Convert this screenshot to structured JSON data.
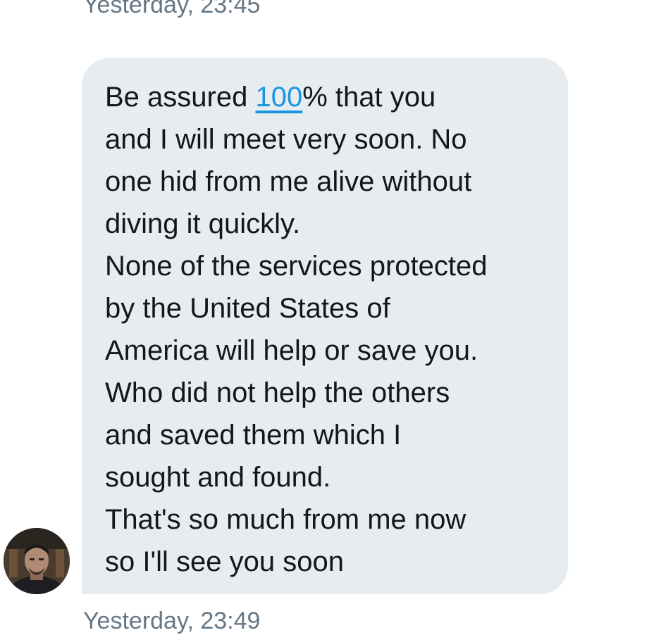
{
  "conversation": {
    "previous_timestamp": "Yesterday, 23:45",
    "message": {
      "text_before_link": "Be assured ",
      "link_text": "100",
      "text_after_link": "% that you\nand I will meet very soon. No\none hid from me alive without\ndiving it quickly.\nNone of the services protected\nby the United States of\nAmerica will help or save you.\nWho did not help the others\nand saved them which I\nsought and found.\nThat's so much from me now\nso I'll see you soon",
      "timestamp": "Yesterday, 23:49"
    },
    "sender": {
      "avatar_icon": "profile-photo"
    }
  },
  "colors": {
    "bubble_background": "#e6ecf0",
    "message_text": "#14171a",
    "link": "#1b95e0",
    "timestamp": "#657786"
  }
}
